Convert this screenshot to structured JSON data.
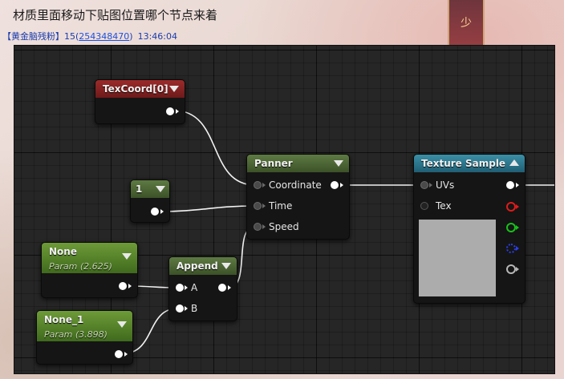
{
  "chat": {
    "message_title": "材质里面移动下贴图位置哪个节点来着",
    "sender_group": "【黄金脑残粉】",
    "sender_name": "15",
    "sender_qq": "254348470",
    "timestamp": "13:46:04",
    "banner_glyph": "少"
  },
  "graph": {
    "nodes": {
      "texcoord": {
        "title": "TexCoord[0]"
      },
      "constant": {
        "title": "1"
      },
      "param_none": {
        "title": "None",
        "subtitle": "Param (2.625)"
      },
      "param_none1": {
        "title": "None_1",
        "subtitle": "Param (3.898)"
      },
      "append": {
        "title": "Append",
        "pin_a": "A",
        "pin_b": "B"
      },
      "panner": {
        "title": "Panner",
        "pin_coordinate": "Coordinate",
        "pin_time": "Time",
        "pin_speed": "Speed"
      },
      "texture_sample": {
        "title": "Texture Sample",
        "pin_uvs": "UVs",
        "pin_tex": "Tex"
      }
    },
    "colors": {
      "output_red": "#e01b1b",
      "output_green": "#17c21a",
      "output_blue": "#2b3fe8",
      "output_alpha": "#b8b8b8",
      "header_red": "#9b2b2b",
      "header_green": "#5e7a43",
      "header_teal": "#3b8fa6",
      "header_lime": "#6e9b38"
    }
  }
}
